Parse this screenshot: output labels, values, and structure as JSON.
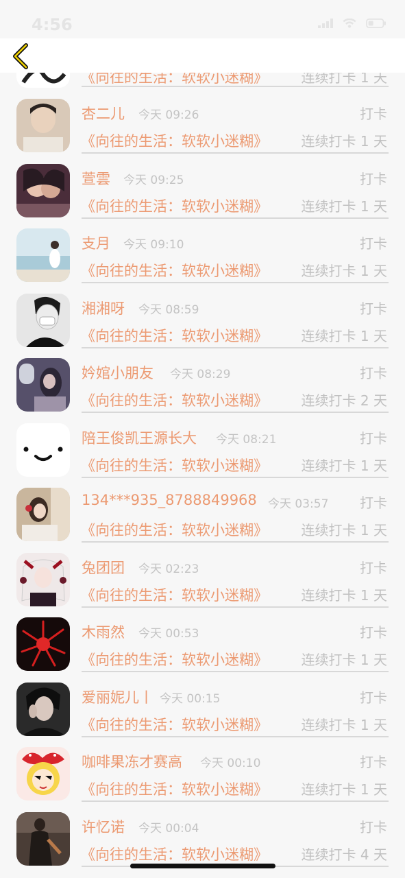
{
  "status_bar": {
    "time": "4:56"
  },
  "nav": {
    "back_icon": "chevron-left-icon",
    "accent": "#f2d300"
  },
  "colors": {
    "accent_text": "#ec9a72",
    "muted_text": "#c0c0c0",
    "divider": "#d8d8d8"
  },
  "partial_top_row": {
    "book": "《向往的生活：软软小迷糊》",
    "streak": "连续打卡 1 天"
  },
  "rows": [
    {
      "name": "杏二儿",
      "time": "今天 09:26",
      "action": "打卡",
      "book": "《向往的生活：软软小迷糊》",
      "streak": "连续打卡 1 天"
    },
    {
      "name": "萱雲",
      "time": "今天 09:25",
      "action": "打卡",
      "book": "《向往的生活：软软小迷糊》",
      "streak": "连续打卡 1 天"
    },
    {
      "name": "支月",
      "time": "今天 09:10",
      "action": "打卡",
      "book": "《向往的生活：软软小迷糊》",
      "streak": "连续打卡 1 天"
    },
    {
      "name": "湘湘呀",
      "time": "今天 08:59",
      "action": "打卡",
      "book": "《向往的生活：软软小迷糊》",
      "streak": "连续打卡 1 天"
    },
    {
      "name": "妗婠小朋友",
      "time": "今天 08:29",
      "action": "打卡",
      "book": "《向往的生活：软软小迷糊》",
      "streak": "连续打卡 2 天"
    },
    {
      "name": "陪王俊凯王源长大",
      "time": "今天 08:21",
      "action": "打卡",
      "book": "《向往的生活：软软小迷糊》",
      "streak": "连续打卡 1 天"
    },
    {
      "name": "134***935_8788849968",
      "time": "今天 03:57",
      "action": "打卡",
      "book": "《向往的生活：软软小迷糊》",
      "streak": "连续打卡 1 天"
    },
    {
      "name": "兔团团",
      "time": "今天 02:23",
      "action": "打卡",
      "book": "《向往的生活：软软小迷糊》",
      "streak": "连续打卡 1 天"
    },
    {
      "name": "木雨然",
      "time": "今天 00:53",
      "action": "打卡",
      "book": "《向往的生活：软软小迷糊》",
      "streak": "连续打卡 1 天"
    },
    {
      "name": "爱丽妮儿丨",
      "time": "今天 00:15",
      "action": "打卡",
      "book": "《向往的生活：软软小迷糊》",
      "streak": "连续打卡 1 天"
    },
    {
      "name": "咖啡果冻才赛高",
      "time": "今天 00:10",
      "action": "打卡",
      "book": "《向往的生活：软软小迷糊》",
      "streak": "连续打卡 1 天"
    },
    {
      "name": "许忆诺",
      "time": "今天 00:04",
      "action": "打卡",
      "book": "《向往的生活：软软小迷糊》",
      "streak": "连续打卡 4 天"
    }
  ]
}
